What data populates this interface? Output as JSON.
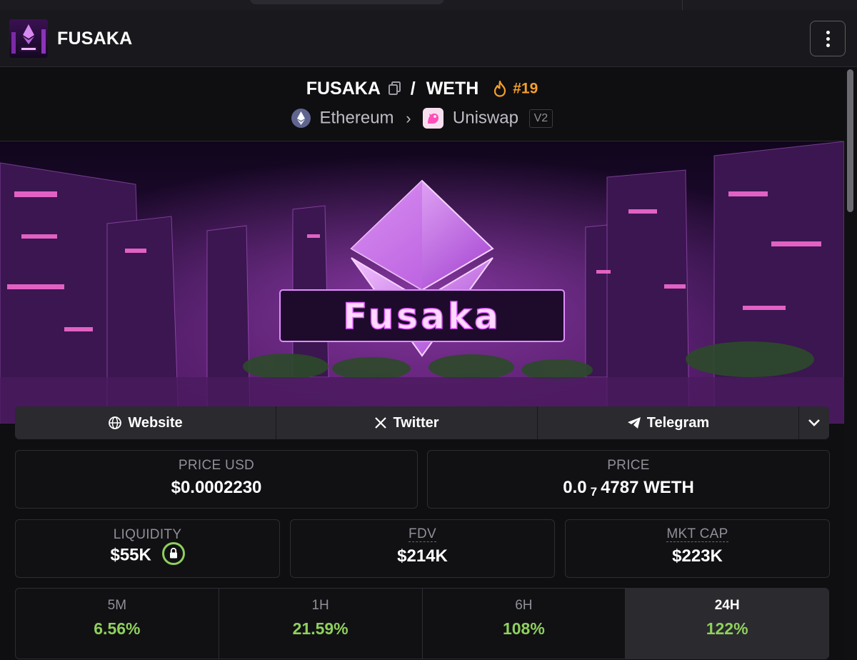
{
  "app": {
    "title": "FUSAKA"
  },
  "pair": {
    "base": "FUSAKA",
    "separator": "/",
    "quote": "WETH",
    "rank": "#19",
    "chain": "Ethereum",
    "dex": "Uniswap",
    "version": "V2"
  },
  "banner": {
    "text": "Fusaka"
  },
  "links": [
    {
      "label": "Website",
      "icon": "globe-icon"
    },
    {
      "label": "Twitter",
      "icon": "x-icon"
    },
    {
      "label": "Telegram",
      "icon": "telegram-icon"
    }
  ],
  "price_usd": {
    "label": "PRICE USD",
    "value": "$0.0002230"
  },
  "price": {
    "label": "PRICE",
    "prefix": "0.0",
    "zeros": "7",
    "digits": "4787",
    "unit": "WETH"
  },
  "liquidity": {
    "label": "LIQUIDITY",
    "value": "$55K",
    "icon": "lock-icon"
  },
  "fdv": {
    "label": "FDV",
    "value": "$214K"
  },
  "mkt_cap": {
    "label": "MKT CAP",
    "value": "$223K"
  },
  "changes": [
    {
      "period": "5M",
      "value": "6.56%"
    },
    {
      "period": "1H",
      "value": "21.59%"
    },
    {
      "period": "6H",
      "value": "108%"
    },
    {
      "period": "24H",
      "value": "122%"
    }
  ],
  "colors": {
    "accent_green": "#8fd05c",
    "rank_orange": "#f4a02a",
    "brand_purple": "#c040e0"
  }
}
